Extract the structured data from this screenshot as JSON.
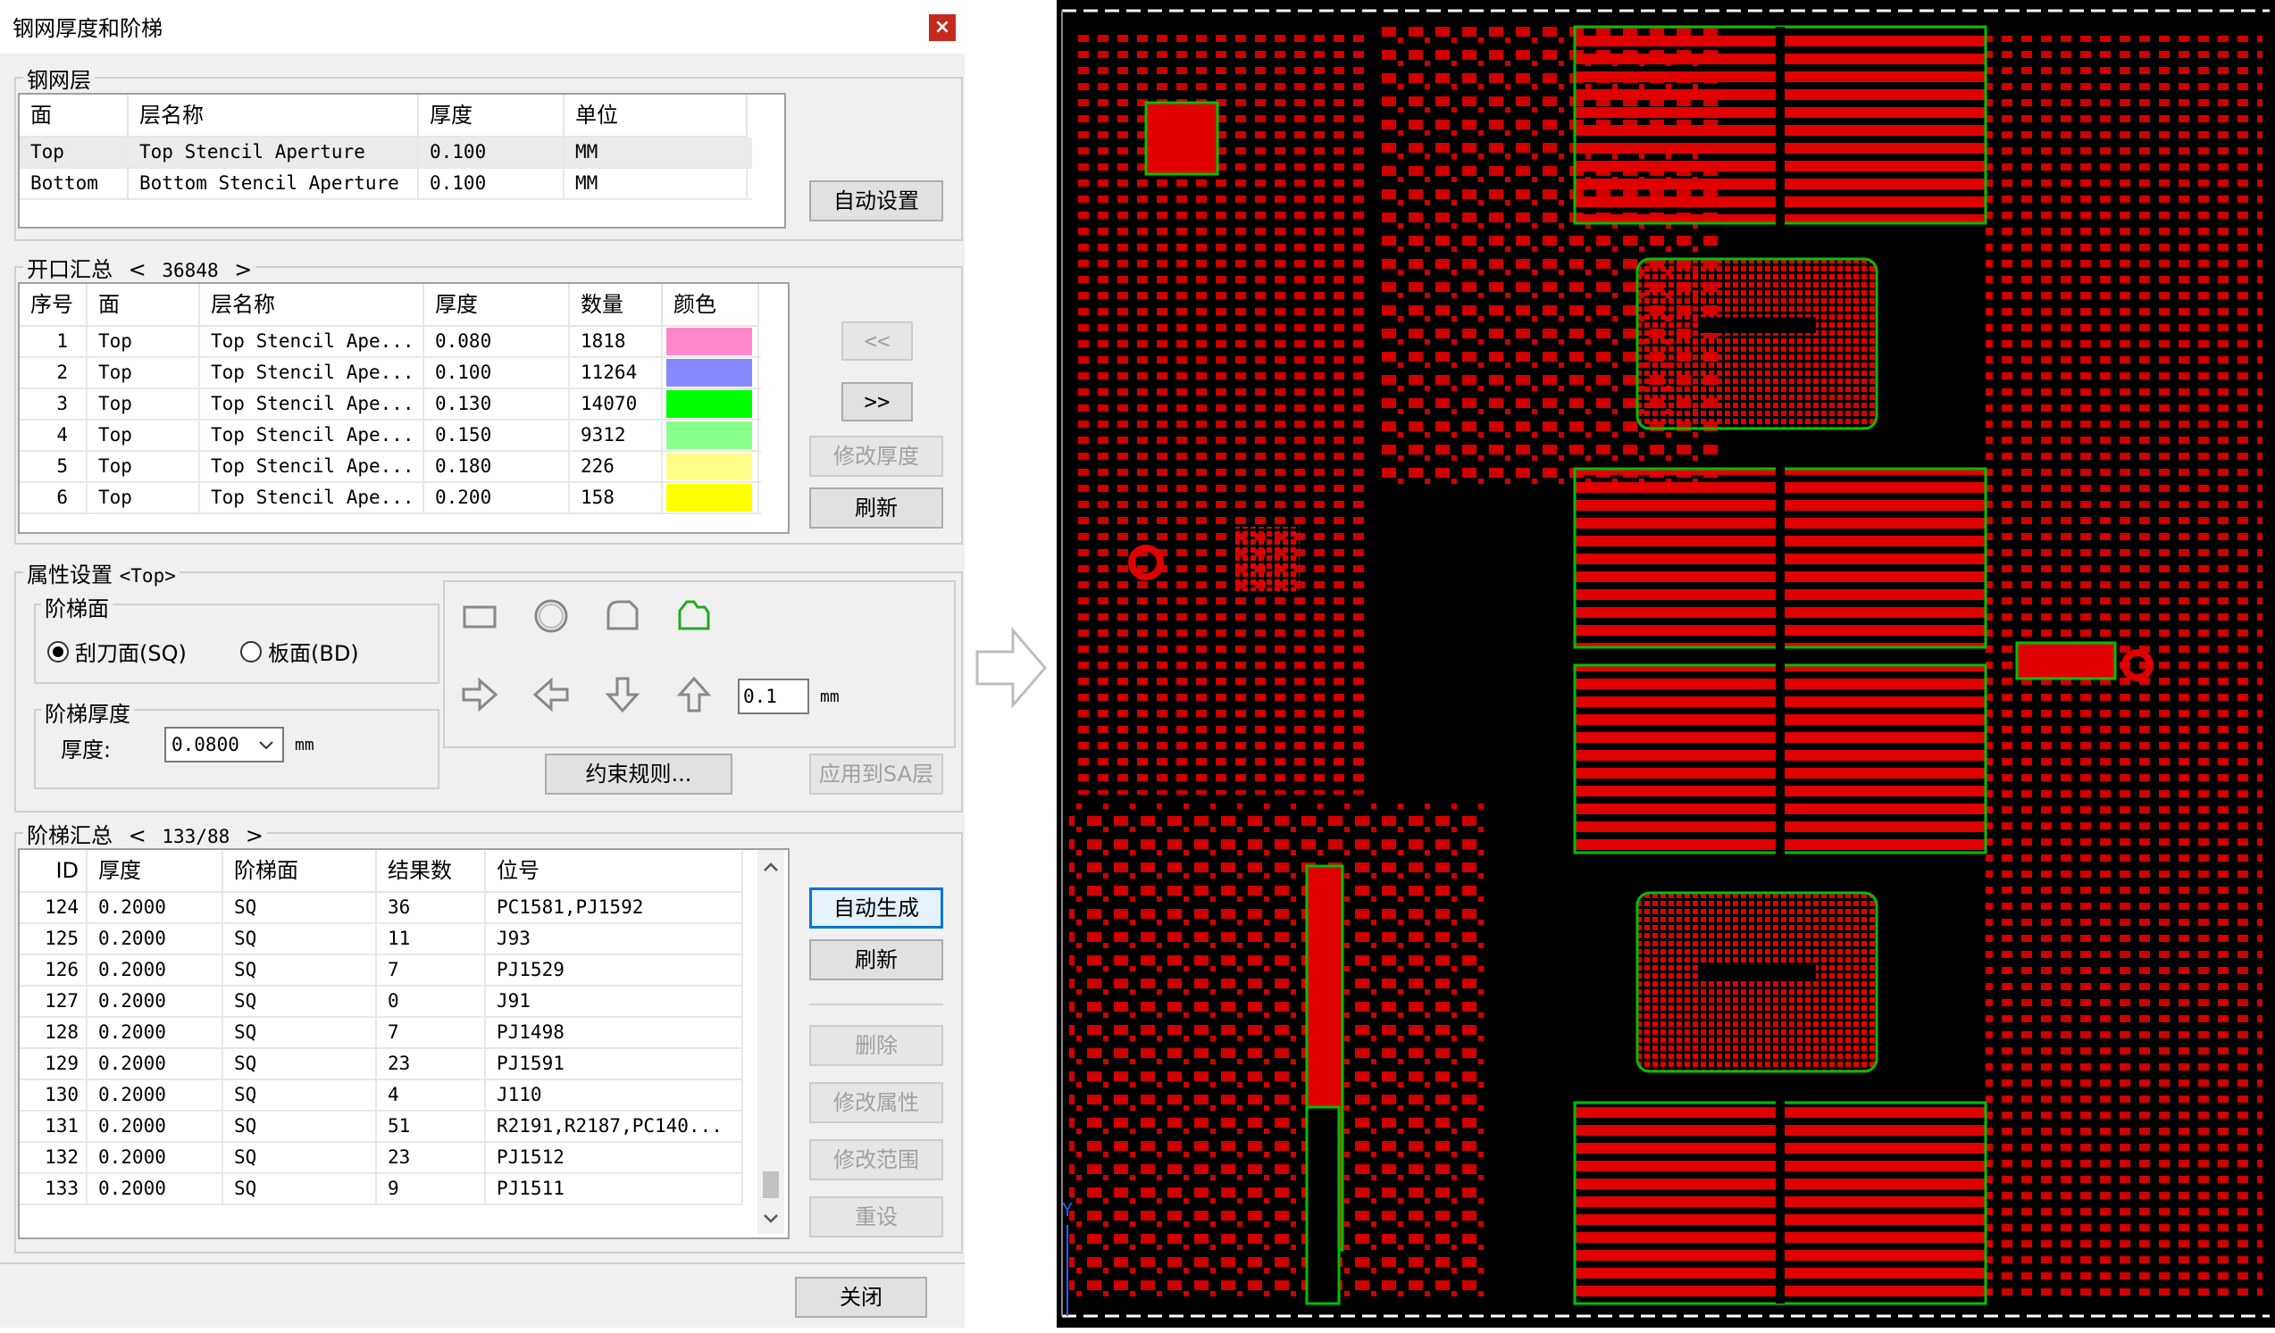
{
  "window": {
    "title": "钢网厚度和阶梯",
    "close_glyph": "×"
  },
  "stencil_layers": {
    "legend": "钢网层",
    "columns": [
      "面",
      "层名称",
      "厚度",
      "单位"
    ],
    "rows": [
      {
        "face": "Top",
        "name": "Top Stencil Aperture",
        "thickness": "0.100",
        "unit": "MM"
      },
      {
        "face": "Bottom",
        "name": "Bottom Stencil Aperture",
        "thickness": "0.100",
        "unit": "MM"
      }
    ],
    "auto_button": "自动设置"
  },
  "opening_summary": {
    "legend": "开口汇总",
    "count": "36848",
    "prev_glyph": "<",
    "next_glyph": ">",
    "columns": [
      "序号",
      "面",
      "层名称",
      "厚度",
      "数量",
      "颜色"
    ],
    "rows": [
      {
        "no": "1",
        "face": "Top",
        "name": "Top Stencil Ape...",
        "thickness": "0.080",
        "qty": "1818",
        "color": "#ff88c8"
      },
      {
        "no": "2",
        "face": "Top",
        "name": "Top Stencil Ape...",
        "thickness": "0.100",
        "qty": "11264",
        "color": "#8888ff"
      },
      {
        "no": "3",
        "face": "Top",
        "name": "Top Stencil Ape...",
        "thickness": "0.130",
        "qty": "14070",
        "color": "#00ff00"
      },
      {
        "no": "4",
        "face": "Top",
        "name": "Top Stencil Ape...",
        "thickness": "0.150",
        "qty": "9312",
        "color": "#88ff88"
      },
      {
        "no": "5",
        "face": "Top",
        "name": "Top Stencil Ape...",
        "thickness": "0.180",
        "qty": "226",
        "color": "#ffff88"
      },
      {
        "no": "6",
        "face": "Top",
        "name": "Top Stencil Ape...",
        "thickness": "0.200",
        "qty": "158",
        "color": "#ffff00"
      }
    ],
    "btn_prev": "<<",
    "btn_next": ">>",
    "btn_modify_thickness": "修改厚度",
    "btn_refresh": "刷新"
  },
  "attributes": {
    "legend": "属性设置",
    "legend_suffix": "<Top>",
    "step_face": {
      "legend": "阶梯面",
      "option_sq": "刮刀面(SQ)",
      "option_bd": "板面(BD)",
      "selected": "sq"
    },
    "step_thickness": {
      "legend": "阶梯厚度",
      "label": "厚度:",
      "value": "0.0800",
      "unit": "mm"
    },
    "offset": {
      "value": "0.1",
      "unit": "mm"
    },
    "btn_constraint": "约束规则...",
    "btn_apply_sa": "应用到SA层"
  },
  "step_summary": {
    "legend": "阶梯汇总",
    "count": "133/88",
    "prev_glyph": "<",
    "next_glyph": ">",
    "columns": [
      "ID",
      "厚度",
      "阶梯面",
      "结果数",
      "位号"
    ],
    "rows": [
      {
        "id": "124",
        "thickness": "0.2000",
        "face": "SQ",
        "count": "36",
        "ref": "PC1581,PJ1592"
      },
      {
        "id": "125",
        "thickness": "0.2000",
        "face": "SQ",
        "count": "11",
        "ref": "J93"
      },
      {
        "id": "126",
        "thickness": "0.2000",
        "face": "SQ",
        "count": "7",
        "ref": "PJ1529"
      },
      {
        "id": "127",
        "thickness": "0.2000",
        "face": "SQ",
        "count": "0",
        "ref": "J91"
      },
      {
        "id": "128",
        "thickness": "0.2000",
        "face": "SQ",
        "count": "7",
        "ref": "PJ1498"
      },
      {
        "id": "129",
        "thickness": "0.2000",
        "face": "SQ",
        "count": "23",
        "ref": "PJ1591"
      },
      {
        "id": "130",
        "thickness": "0.2000",
        "face": "SQ",
        "count": "4",
        "ref": "J110"
      },
      {
        "id": "131",
        "thickness": "0.2000",
        "face": "SQ",
        "count": "51",
        "ref": "R2191,R2187,PC140..."
      },
      {
        "id": "132",
        "thickness": "0.2000",
        "face": "SQ",
        "count": "23",
        "ref": "PJ1512"
      },
      {
        "id": "133",
        "thickness": "0.2000",
        "face": "SQ",
        "count": "9",
        "ref": "PJ1511"
      }
    ],
    "btn_auto_generate": "自动生成",
    "btn_refresh": "刷新",
    "btn_delete": "删除",
    "btn_modify_attr": "修改属性",
    "btn_modify_range": "修改范围",
    "btn_reset": "重设"
  },
  "footer": {
    "btn_close": "关闭"
  },
  "pcb_view": {
    "axis_label": "Y",
    "colors": {
      "pad": "#ff0000",
      "outline": "#00c000",
      "background": "#000000"
    }
  }
}
